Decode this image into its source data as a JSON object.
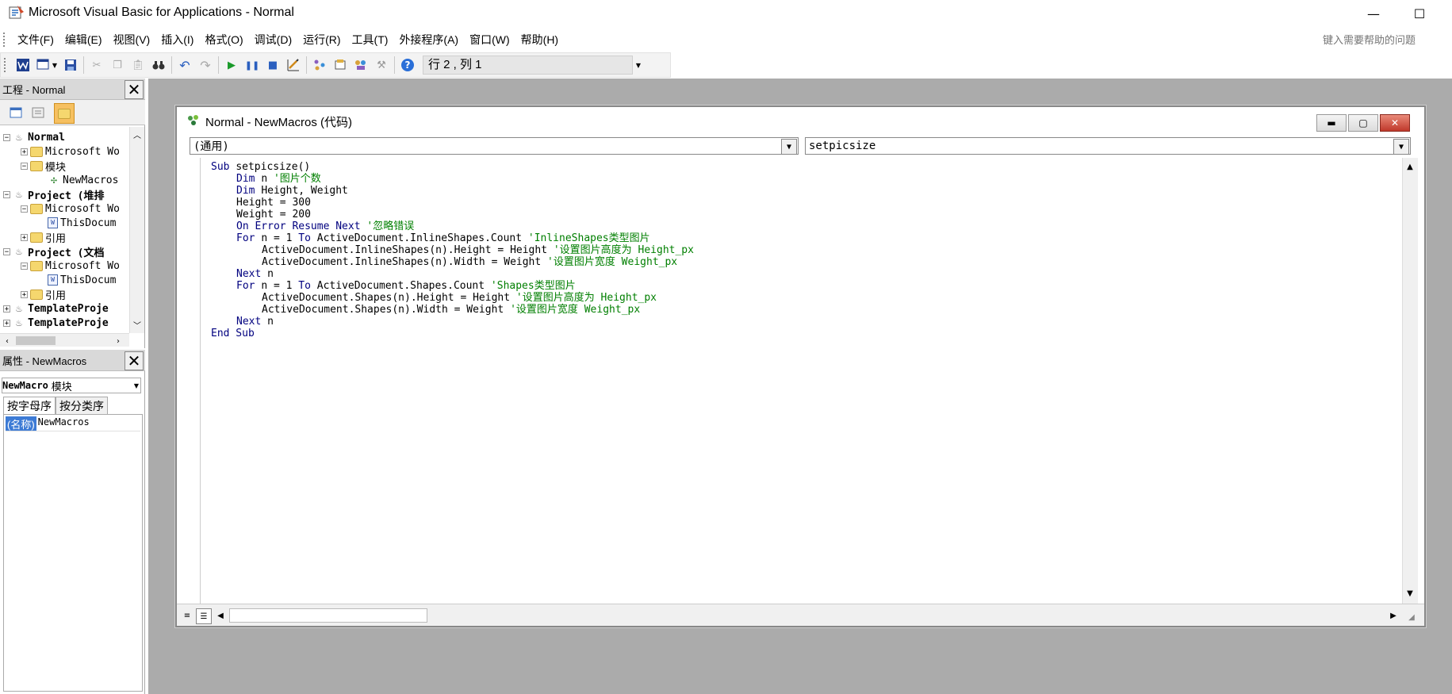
{
  "window": {
    "title": "Microsoft Visual Basic for Applications - Normal",
    "minimize_glyph": "—",
    "maximize_glyph": "☐"
  },
  "menu": {
    "items": [
      "文件(F)",
      "编辑(E)",
      "视图(V)",
      "插入(I)",
      "格式(O)",
      "调试(D)",
      "运行(R)",
      "工具(T)",
      "外接程序(A)",
      "窗口(W)",
      "帮助(H)"
    ],
    "help_placeholder": "键入需要帮助的问题"
  },
  "toolbar": {
    "position": "行 2 , 列 1"
  },
  "project_panel": {
    "title": "工程 - Normal",
    "tree": [
      {
        "label": "Normal",
        "level": 0,
        "icon": "project-icon",
        "bold": true,
        "expander": "−"
      },
      {
        "label": "Microsoft Wo",
        "level": 1,
        "icon": "folder-icon",
        "bold": false,
        "expander": "+"
      },
      {
        "label": "模块",
        "level": 1,
        "icon": "folder-icon",
        "bold": false,
        "expander": "−"
      },
      {
        "label": "NewMacros",
        "level": 2,
        "icon": "module-icon",
        "bold": false,
        "expander": ""
      },
      {
        "label": "Project (堆排",
        "level": 0,
        "icon": "project-icon",
        "bold": true,
        "expander": "−"
      },
      {
        "label": "Microsoft Wo",
        "level": 1,
        "icon": "folder-icon",
        "bold": false,
        "expander": "−"
      },
      {
        "label": "ThisDocum",
        "level": 2,
        "icon": "document-icon",
        "bold": false,
        "expander": ""
      },
      {
        "label": "引用",
        "level": 1,
        "icon": "folder-icon",
        "bold": false,
        "expander": "+"
      },
      {
        "label": "Project (文档",
        "level": 0,
        "icon": "project-icon",
        "bold": true,
        "expander": "−"
      },
      {
        "label": "Microsoft Wo",
        "level": 1,
        "icon": "folder-icon",
        "bold": false,
        "expander": "−"
      },
      {
        "label": "ThisDocum",
        "level": 2,
        "icon": "document-icon",
        "bold": false,
        "expander": ""
      },
      {
        "label": "引用",
        "level": 1,
        "icon": "folder-icon",
        "bold": false,
        "expander": "+"
      },
      {
        "label": "TemplateProje",
        "level": 0,
        "icon": "project-icon",
        "bold": true,
        "expander": "+"
      },
      {
        "label": "TemplateProje",
        "level": 0,
        "icon": "project-icon",
        "bold": true,
        "expander": "+"
      }
    ]
  },
  "properties_panel": {
    "title": "属性 - NewMacros",
    "object_name": "NewMacro",
    "object_type": "模块",
    "tabs": [
      "按字母序",
      "按分类序"
    ],
    "rows": [
      {
        "key": "(名称)",
        "value": "NewMacros"
      }
    ]
  },
  "code_window": {
    "title": "Normal - NewMacros (代码)",
    "object_combo": "(通用)",
    "procedure_combo": "setpicsize",
    "lines": [
      {
        "indent": 0,
        "parts": [
          [
            "kw",
            "Sub "
          ],
          [
            "",
            "setpicsize()"
          ]
        ]
      },
      {
        "indent": 1,
        "parts": [
          [
            "kw",
            "Dim "
          ],
          [
            "",
            "n "
          ],
          [
            "cm",
            "'图片个数"
          ]
        ]
      },
      {
        "indent": 1,
        "parts": [
          [
            "kw",
            "Dim "
          ],
          [
            "",
            "Height, Weight"
          ]
        ]
      },
      {
        "indent": 1,
        "parts": [
          [
            "",
            "Height = 300"
          ]
        ]
      },
      {
        "indent": 1,
        "parts": [
          [
            "",
            "Weight = 200"
          ]
        ]
      },
      {
        "indent": 1,
        "parts": [
          [
            "kw",
            "On Error Resume Next "
          ],
          [
            "cm",
            "'忽略错误"
          ]
        ]
      },
      {
        "indent": 1,
        "parts": [
          [
            "kw",
            "For "
          ],
          [
            "",
            "n = 1 "
          ],
          [
            "kw",
            "To "
          ],
          [
            "",
            "ActiveDocument.InlineShapes.Count "
          ],
          [
            "cm",
            "'InlineShapes类型图片"
          ]
        ]
      },
      {
        "indent": 2,
        "parts": [
          [
            "",
            "ActiveDocument.InlineShapes(n).Height = Height "
          ],
          [
            "cm",
            "'设置图片高度为 Height_px"
          ]
        ]
      },
      {
        "indent": 2,
        "parts": [
          [
            "",
            "ActiveDocument.InlineShapes(n).Width = Weight "
          ],
          [
            "cm",
            "'设置图片宽度 Weight_px"
          ]
        ]
      },
      {
        "indent": 1,
        "parts": [
          [
            "kw",
            "Next "
          ],
          [
            "",
            "n"
          ]
        ]
      },
      {
        "indent": 1,
        "parts": [
          [
            "kw",
            "For "
          ],
          [
            "",
            "n = 1 "
          ],
          [
            "kw",
            "To "
          ],
          [
            "",
            "ActiveDocument.Shapes.Count "
          ],
          [
            "cm",
            "'Shapes类型图片"
          ]
        ]
      },
      {
        "indent": 2,
        "parts": [
          [
            "",
            "ActiveDocument.Shapes(n).Height = Height "
          ],
          [
            "cm",
            "'设置图片高度为 Height_px"
          ]
        ]
      },
      {
        "indent": 2,
        "parts": [
          [
            "",
            "ActiveDocument.Shapes(n).Width = Weight "
          ],
          [
            "cm",
            "'设置图片宽度 Weight_px"
          ]
        ]
      },
      {
        "indent": 1,
        "parts": [
          [
            "kw",
            "Next "
          ],
          [
            "",
            "n"
          ]
        ]
      },
      {
        "indent": 0,
        "parts": [
          [
            "kw",
            "End Sub"
          ]
        ]
      }
    ]
  },
  "colors": {
    "keyword": "#00007f",
    "comment": "#007f00",
    "workspace": "#ababab",
    "selection": "#3d7bd5"
  }
}
